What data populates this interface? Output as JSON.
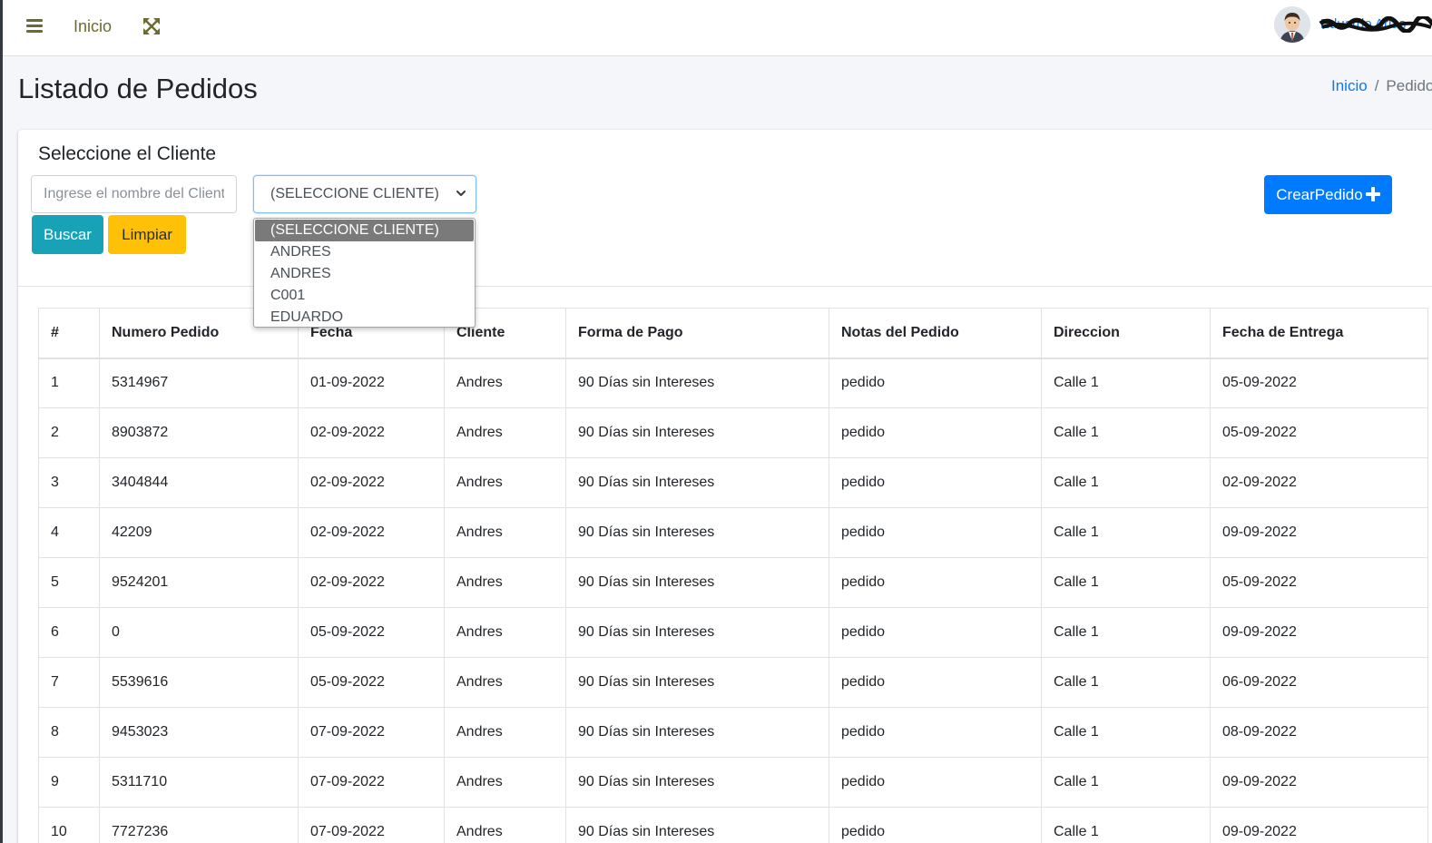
{
  "navbar": {
    "home_label": "Inicio",
    "user_name": "Eduardo Arias"
  },
  "content_header": {
    "title": "Listado de Pedidos",
    "breadcrumb": [
      "Inicio",
      "Pedidos"
    ]
  },
  "filters": {
    "subtitle": "Seleccione el Cliente",
    "search_placeholder": "Ingrese el nombre del Cliente",
    "select_value": "(SELECCIONE CLIENTE)",
    "select_options": [
      "(SELECCIONE CLIENTE)",
      "ANDRES",
      "ANDRES",
      "C001",
      "EDUARDO"
    ],
    "search_button": "Buscar",
    "clear_button": "Limpiar",
    "create_button": "CrearPedido"
  },
  "table": {
    "headers": [
      "#",
      "Numero Pedido",
      "Fecha",
      "Cliente",
      "Forma de Pago",
      "Notas del Pedido",
      "Direccion",
      "Fecha de Entrega"
    ],
    "rows": [
      [
        "1",
        "5314967",
        "01-09-2022",
        "Andres",
        "90 Días sin Intereses",
        "pedido",
        "Calle 1",
        "05-09-2022"
      ],
      [
        "2",
        "8903872",
        "02-09-2022",
        "Andres",
        "90 Días sin Intereses",
        "pedido",
        "Calle 1",
        "05-09-2022"
      ],
      [
        "3",
        "3404844",
        "02-09-2022",
        "Andres",
        "90 Días sin Intereses",
        "pedido",
        "Calle 1",
        "02-09-2022"
      ],
      [
        "4",
        "42209",
        "02-09-2022",
        "Andres",
        "90 Días sin Intereses",
        "pedido",
        "Calle 1",
        "09-09-2022"
      ],
      [
        "5",
        "9524201",
        "02-09-2022",
        "Andres",
        "90 Días sin Intereses",
        "pedido",
        "Calle 1",
        "05-09-2022"
      ],
      [
        "6",
        "0",
        "05-09-2022",
        "Andres",
        "90 Días sin Intereses",
        "pedido",
        "Calle 1",
        "09-09-2022"
      ],
      [
        "7",
        "5539616",
        "05-09-2022",
        "Andres",
        "90 Días sin Intereses",
        "pedido",
        "Calle 1",
        "06-09-2022"
      ],
      [
        "8",
        "9453023",
        "07-09-2022",
        "Andres",
        "90 Días sin Intereses",
        "pedido",
        "Calle 1",
        "08-09-2022"
      ],
      [
        "9",
        "5311710",
        "07-09-2022",
        "Andres",
        "90 Días sin Intereses",
        "pedido",
        "Calle 1",
        "09-09-2022"
      ],
      [
        "10",
        "7727236",
        "07-09-2022",
        "Andres",
        "90 Días sin Intereses",
        "pedido",
        "Calle 1",
        "09-09-2022"
      ]
    ]
  },
  "icons": {
    "menu": "bars-icon",
    "fullscreen": "expand-arrows-icon",
    "select_arrow": "chevron-down-icon",
    "create": "plus-icon",
    "user": "avatar"
  },
  "colors": {
    "primary": "#007bff",
    "info": "#17a2b8",
    "warning": "#ffc107",
    "nav_icon": "#6b6b2e",
    "page_bg": "#f4f6f9"
  }
}
